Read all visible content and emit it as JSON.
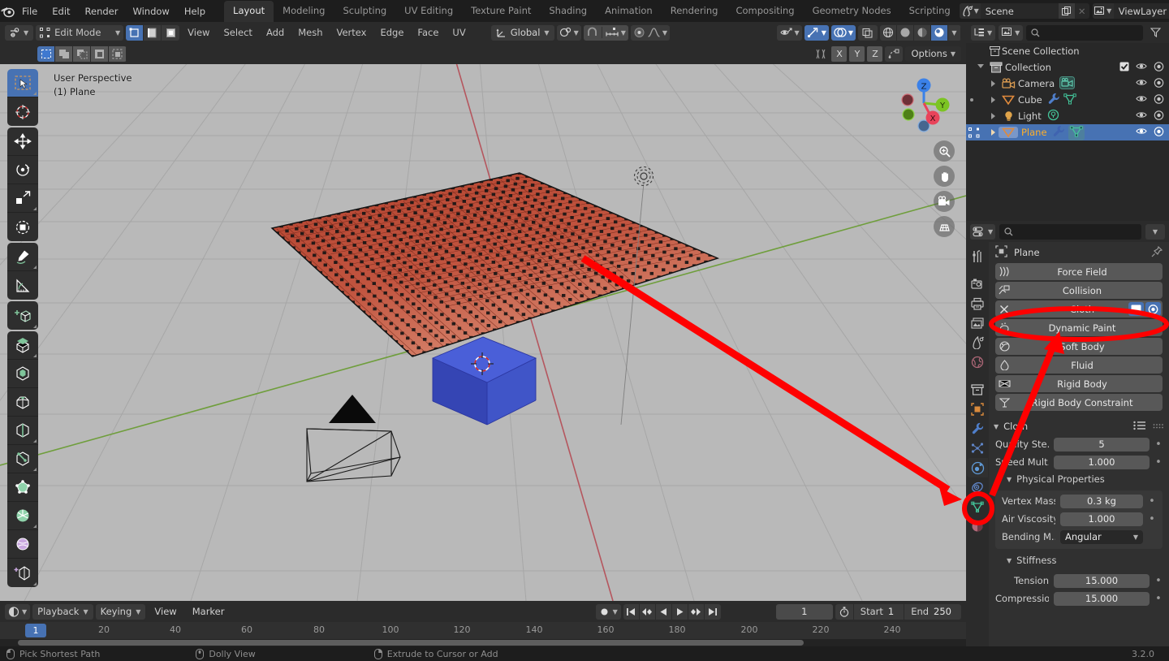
{
  "topbar": {
    "logo_icon": "blender-logo-icon",
    "menus": [
      "File",
      "Edit",
      "Render",
      "Window",
      "Help"
    ],
    "workspaces": [
      {
        "label": "Layout",
        "active": true
      },
      {
        "label": "Modeling",
        "active": false
      },
      {
        "label": "Sculpting",
        "active": false
      },
      {
        "label": "UV Editing",
        "active": false
      },
      {
        "label": "Texture Paint",
        "active": false
      },
      {
        "label": "Shading",
        "active": false
      },
      {
        "label": "Animation",
        "active": false
      },
      {
        "label": "Rendering",
        "active": false
      },
      {
        "label": "Compositing",
        "active": false
      },
      {
        "label": "Geometry Nodes",
        "active": false
      },
      {
        "label": "Scripting",
        "active": false
      }
    ],
    "scene_name": "Scene",
    "viewlayer_name": "ViewLayer"
  },
  "viewport_header": {
    "editor_icon": "editor-type-icon",
    "mode": "Edit Mode",
    "select_modes": [
      "vertex-select-icon",
      "edge-select-icon",
      "face-select-icon"
    ],
    "menus": [
      "View",
      "Select",
      "Add",
      "Mesh",
      "Vertex",
      "Edge",
      "Face",
      "UV"
    ],
    "transform_orientation": "Global",
    "pivot_icon": "pivot-point-icon",
    "snap_icon": "snap-magnet-icon",
    "snap_target_icon": "snap-increment-icon",
    "proportional_icon": "proportional-edit-icon",
    "falloff_icon": "proportional-falloff-icon",
    "visibility_icon": "object-visibility-icon",
    "gizmo_icon": "gizmo-icon",
    "overlays_icon": "overlays-icon",
    "xray_icon": "toggle-xray-icon",
    "shading_modes": [
      "wireframe-shading-icon",
      "solid-shading-icon",
      "material-preview-icon",
      "rendered-shading-icon"
    ],
    "shading_active_index": 3
  },
  "viewport_subheader": {
    "select_tool_modes": [
      "set-select-icon",
      "extend-select-icon",
      "subtract-select-icon",
      "invert-select-icon",
      "intersect-select-icon"
    ],
    "active_index": 0,
    "mesh_edit_icon": "mesh-edit-mode-icon",
    "axis_buttons": [
      "X",
      "Y",
      "Z"
    ],
    "mirror_icon": "mirror-icon",
    "options_label": "Options"
  },
  "viewport": {
    "view_name": "User Perspective",
    "active_object": "(1) Plane",
    "gizmo_axes": [
      {
        "label": "Z",
        "color": "#3b81e8",
        "filled": true
      },
      {
        "label": "Y",
        "color": "#7cc423",
        "filled": true
      },
      {
        "label": "X",
        "color": "#e8435a",
        "filled": true
      },
      {
        "label": "",
        "color": "#9c3040",
        "filled": false
      },
      {
        "label": "",
        "color": "#4e8016",
        "filled": false
      },
      {
        "label": "",
        "color": "#2f5c96",
        "filled": false
      }
    ],
    "nav_buttons": [
      "zoom-icon",
      "pan-hand-icon",
      "camera-view-icon",
      "toggle-orthographic-icon"
    ],
    "objects": {
      "plane_color": "#c1543f",
      "cube_color": "#3b4fc4",
      "camera_label": "camera-wireframe",
      "light_label": "light-gizmo"
    }
  },
  "toolbar": {
    "tools": [
      {
        "name": "tweak-select-box-tool",
        "active": true
      },
      {
        "name": "cursor-tool",
        "active": false
      },
      {
        "name": "move-tool",
        "active": false
      },
      {
        "name": "rotate-tool",
        "active": false
      },
      {
        "name": "scale-tool",
        "active": false
      },
      {
        "name": "transform-tool",
        "active": false
      },
      {
        "name": "annotate-tool",
        "active": false
      },
      {
        "name": "measure-tool",
        "active": false
      },
      {
        "name": "add-cube-tool",
        "active": false
      },
      {
        "name": "extrude-region-tool",
        "active": false
      },
      {
        "name": "inset-faces-tool",
        "active": false
      },
      {
        "name": "bevel-tool",
        "active": false
      },
      {
        "name": "loop-cut-tool",
        "active": false
      },
      {
        "name": "knife-tool",
        "active": false
      },
      {
        "name": "poly-build-tool",
        "active": false
      },
      {
        "name": "spin-tool",
        "active": false
      },
      {
        "name": "smooth-tool",
        "active": false
      },
      {
        "name": "shrink-fatten-tool",
        "active": false
      }
    ]
  },
  "outliner": {
    "display_mode_icon": "outliner-display-mode-icon",
    "filter_icon": "filter-icon",
    "search_placeholder": "",
    "rows": [
      {
        "label": "Scene Collection",
        "depth": 0,
        "icon": "scene-collection-icon",
        "expander": "none",
        "selected": false,
        "badges": [],
        "has_checkbox": false,
        "eye": false,
        "camera": false
      },
      {
        "label": "Collection",
        "depth": 1,
        "icon": "collection-icon",
        "expander": "down",
        "selected": false,
        "badges": [],
        "has_checkbox": true,
        "eye": true,
        "camera": true
      },
      {
        "label": "Camera",
        "depth": 2,
        "icon": "camera-object-icon",
        "expander": "right",
        "selected": false,
        "badges": [
          "camera-data-icon"
        ],
        "has_checkbox": false,
        "eye": true,
        "camera": true
      },
      {
        "label": "Cube",
        "depth": 2,
        "icon": "mesh-object-icon",
        "expander": "right",
        "selected": false,
        "badges": [
          "modifier-wrench-icon",
          "mesh-data-icon"
        ],
        "has_checkbox": false,
        "eye": true,
        "camera": true,
        "dot": true
      },
      {
        "label": "Light",
        "depth": 2,
        "icon": "light-object-icon",
        "expander": "right",
        "selected": false,
        "badges": [
          "light-data-icon"
        ],
        "has_checkbox": false,
        "eye": true,
        "camera": true
      },
      {
        "label": "Plane",
        "depth": 2,
        "icon": "mesh-object-icon",
        "expander": "right",
        "selected": true,
        "badges": [
          "modifier-wrench-icon",
          "mesh-data-icon"
        ],
        "has_checkbox": false,
        "eye": true,
        "camera": true
      }
    ]
  },
  "properties": {
    "editor_icon": "properties-editor-icon",
    "search_placeholder": "",
    "options_icon": "options-chevron-icon",
    "tabs": [
      {
        "name": "tool-tab",
        "icon": "tool-icon",
        "active": false
      },
      {
        "name": "render-tab",
        "icon": "render-camera-icon",
        "active": false
      },
      {
        "name": "output-tab",
        "icon": "printer-icon",
        "active": false
      },
      {
        "name": "view-layer-tab",
        "icon": "images-icon",
        "active": false
      },
      {
        "name": "scene-tab",
        "icon": "scene-cone-icon",
        "active": false
      },
      {
        "name": "world-tab",
        "icon": "world-globe-icon",
        "active": false
      },
      {
        "name": "collection-tab",
        "icon": "collection-box-icon",
        "active": false
      },
      {
        "name": "object-tab",
        "icon": "object-square-icon",
        "active": false
      },
      {
        "name": "modifier-tab",
        "icon": "wrench-icon",
        "active": false
      },
      {
        "name": "particles-tab",
        "icon": "particles-icon",
        "active": false
      },
      {
        "name": "physics-tab",
        "icon": "physics-orbit-icon",
        "active": true
      },
      {
        "name": "constraints-tab",
        "icon": "constraint-icon",
        "active": false
      },
      {
        "name": "data-tab",
        "icon": "mesh-data-triangle-icon",
        "active": false
      },
      {
        "name": "material-tab",
        "icon": "material-sphere-icon",
        "active": false
      }
    ],
    "breadcrumb_object": "Plane",
    "breadcrumb_icon": "object-square-icon",
    "pin_icon": "pin-icon",
    "physics_buttons": [
      {
        "label": "Force Field",
        "icon": "force-field-icon",
        "enabled": false
      },
      {
        "label": "Collision",
        "icon": "collision-icon",
        "enabled": false
      },
      {
        "label": "Cloth",
        "icon": "x-icon",
        "enabled": true,
        "toggles": [
          "display-in-viewport-icon",
          "render-visibility-icon"
        ]
      },
      {
        "label": "Dynamic Paint",
        "icon": "dynamic-paint-icon",
        "enabled": false
      },
      {
        "label": "Soft Body",
        "icon": "soft-body-icon",
        "enabled": false
      },
      {
        "label": "Fluid",
        "icon": "fluid-drop-icon",
        "enabled": false
      },
      {
        "label": "Rigid Body",
        "icon": "rigid-body-icon",
        "enabled": false
      },
      {
        "label": "Rigid Body Constraint",
        "icon": "rigid-body-constraint-icon",
        "enabled": false
      }
    ],
    "cloth_panel": {
      "title": "Cloth",
      "preset_icon": "presets-list-icon",
      "grip_icon": "grip-dots-icon",
      "fields": [
        {
          "label": "Quality Ste...",
          "value": "5",
          "type": "number"
        },
        {
          "label": "Speed Mult...",
          "value": "1.000",
          "type": "number"
        }
      ],
      "physical_properties": {
        "title": "Physical Properties",
        "fields": [
          {
            "label": "Vertex Mass",
            "value": "0.3 kg",
            "type": "number"
          },
          {
            "label": "Air Viscosity",
            "value": "1.000",
            "type": "number"
          },
          {
            "label": "Bending M...",
            "value": "Angular",
            "type": "enum"
          }
        ]
      },
      "stiffness": {
        "title": "Stiffness",
        "fields": [
          {
            "label": "Tension",
            "value": "15.000",
            "type": "number"
          },
          {
            "label": "Compressio",
            "value": "15.000",
            "type": "number"
          }
        ]
      }
    }
  },
  "timeline": {
    "editor_icon": "timeline-editor-icon",
    "menus": [
      {
        "label": "Playback",
        "dropdown": true
      },
      {
        "label": "Keying",
        "dropdown": true
      },
      {
        "label": "View",
        "dropdown": false
      },
      {
        "label": "Marker",
        "dropdown": false
      }
    ],
    "record_icon": "auto-keying-record-icon",
    "transport": [
      "jump-to-start-icon",
      "jump-prev-keyframe-icon",
      "play-reverse-icon",
      "play-icon",
      "jump-next-keyframe-icon",
      "jump-to-end-icon"
    ],
    "current_frame": "1",
    "timer_icon": "stopwatch-icon",
    "start_label": "Start",
    "start_value": "1",
    "end_label": "End",
    "end_value": "250",
    "ticks": [
      "20",
      "40",
      "60",
      "80",
      "100",
      "120",
      "140",
      "160",
      "180",
      "200",
      "220",
      "240"
    ],
    "playhead_label": "1"
  },
  "statusbar": {
    "items": [
      {
        "icon": "mouse-left-icon",
        "label": "Pick Shortest Path"
      },
      {
        "icon": "mouse-middle-icon",
        "label": "Dolly View"
      },
      {
        "icon": "mouse-right-icon",
        "label": "Extrude to Cursor or Add"
      }
    ],
    "version": "3.2.0"
  },
  "annotation": {
    "highlight_color": "#ff0000",
    "ellipse_targets": [
      "cloth-physics-button",
      "physics-properties-tab"
    ],
    "arrow": "arrow-from-physics-tab-to-cloth-button"
  }
}
